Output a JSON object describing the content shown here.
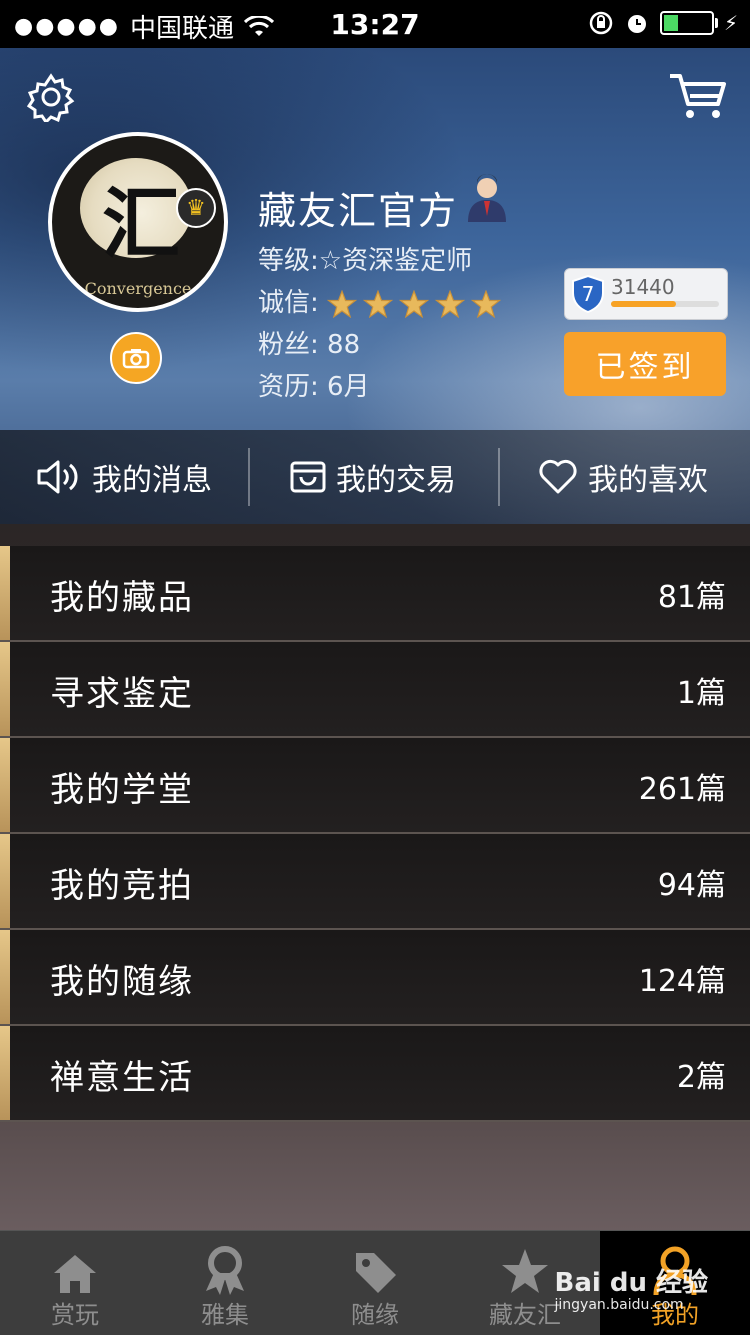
{
  "status_bar": {
    "carrier": "中国联通",
    "time": "13:27"
  },
  "profile": {
    "name": "藏友汇官方",
    "level_label": "等级:",
    "level_value": "资深鉴定师",
    "credit_label": "诚信:",
    "credit_stars": 5,
    "fans_label": "粉丝:",
    "fans_value": "88",
    "tenure_label": "资历:",
    "tenure_value": "6月",
    "avatar_text": "Convergence",
    "level_badge": "7",
    "points": "31440",
    "points_progress": 0.6,
    "sign_in_label": "已签到"
  },
  "quick_actions": [
    {
      "label": "我的消息"
    },
    {
      "label": "我的交易"
    },
    {
      "label": "我的喜欢"
    }
  ],
  "menu": [
    {
      "label": "我的藏品",
      "count": "81篇"
    },
    {
      "label": "寻求鉴定",
      "count": "1篇"
    },
    {
      "label": "我的学堂",
      "count": "261篇"
    },
    {
      "label": "我的竞拍",
      "count": "94篇"
    },
    {
      "label": "我的随缘",
      "count": "124篇"
    },
    {
      "label": "禅意生活",
      "count": "2篇"
    }
  ],
  "tabs": [
    {
      "label": "赏玩"
    },
    {
      "label": "雅集"
    },
    {
      "label": "随缘"
    },
    {
      "label": "藏友汇"
    },
    {
      "label": "我的"
    }
  ],
  "watermark": {
    "brand": "Bai du 经验",
    "url": "jingyan.baidu.com"
  },
  "colors": {
    "accent": "#f8a12a",
    "active_tab": "#f2a226",
    "stripe": "#d8b578"
  }
}
